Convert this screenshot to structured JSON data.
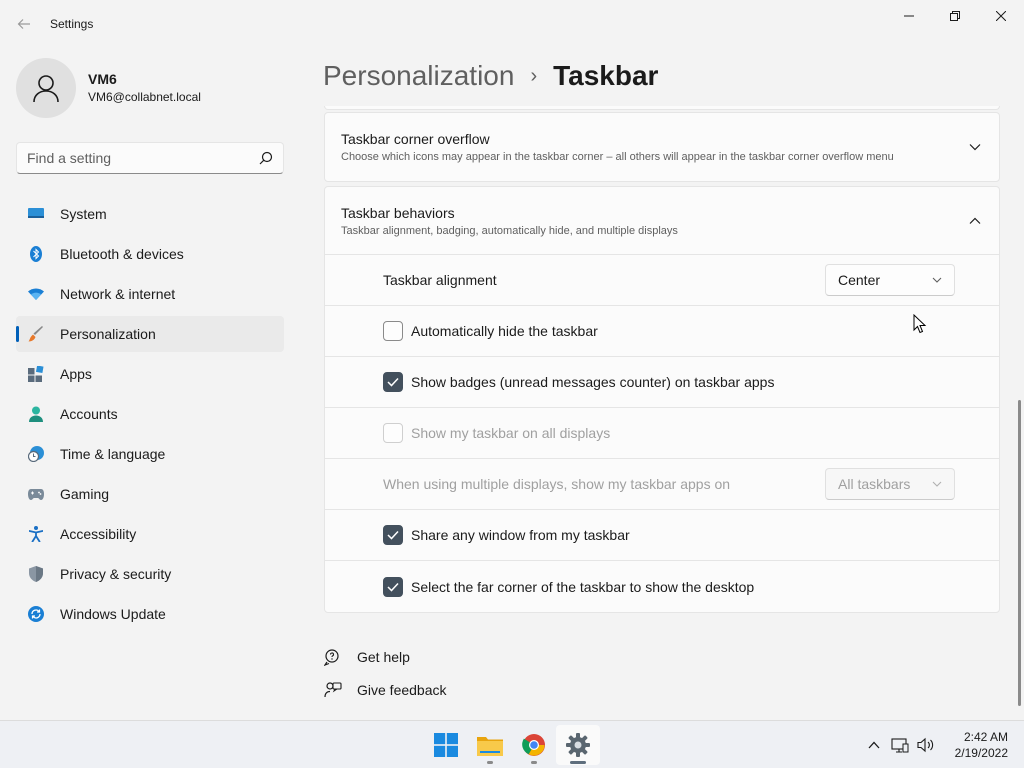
{
  "window": {
    "title": "Settings",
    "controls": [
      "minimize",
      "maximize",
      "close"
    ]
  },
  "profile": {
    "name": "VM6",
    "email": "VM6@collabnet.local"
  },
  "search": {
    "placeholder": "Find a setting"
  },
  "sidebar": {
    "items": [
      {
        "label": "System",
        "icon": "monitor-icon"
      },
      {
        "label": "Bluetooth & devices",
        "icon": "bluetooth-icon"
      },
      {
        "label": "Network & internet",
        "icon": "wifi-icon"
      },
      {
        "label": "Personalization",
        "icon": "brush-icon",
        "active": true
      },
      {
        "label": "Apps",
        "icon": "apps-icon"
      },
      {
        "label": "Accounts",
        "icon": "person-icon"
      },
      {
        "label": "Time & language",
        "icon": "clock-globe-icon"
      },
      {
        "label": "Gaming",
        "icon": "gamepad-icon"
      },
      {
        "label": "Accessibility",
        "icon": "accessibility-icon"
      },
      {
        "label": "Privacy & security",
        "icon": "shield-icon"
      },
      {
        "label": "Windows Update",
        "icon": "update-icon"
      }
    ]
  },
  "breadcrumb": {
    "parent": "Personalization",
    "separator": "›",
    "current": "Taskbar"
  },
  "corner_overflow": {
    "title": "Taskbar corner overflow",
    "description": "Choose which icons may appear in the taskbar corner – all others will appear in the taskbar corner overflow menu",
    "expanded": false
  },
  "behaviors": {
    "title": "Taskbar behaviors",
    "description": "Taskbar alignment, badging, automatically hide, and multiple displays",
    "expanded": true,
    "alignment": {
      "label": "Taskbar alignment",
      "value": "Center"
    },
    "auto_hide": {
      "label": "Automatically hide the taskbar",
      "checked": false
    },
    "badges": {
      "label": "Show badges (unread messages counter) on taskbar apps",
      "checked": true
    },
    "all_displays": {
      "label": "Show my taskbar on all displays",
      "checked": false,
      "disabled": true
    },
    "multi_display_apps": {
      "label": "When using multiple displays, show my taskbar apps on",
      "value": "All taskbars",
      "disabled": true
    },
    "share_window": {
      "label": "Share any window from my taskbar",
      "checked": true
    },
    "far_corner": {
      "label": "Select the far corner of the taskbar to show the desktop",
      "checked": true
    }
  },
  "links": {
    "help": "Get help",
    "feedback": "Give feedback"
  },
  "taskbar": {
    "apps": [
      "start-icon",
      "file-explorer-icon",
      "chrome-icon",
      "settings-icon"
    ],
    "time": "2:42 AM",
    "date": "2/19/2022"
  },
  "colors": {
    "accent": "#005fb8",
    "checkbox_checked": "#43505d",
    "background": "#f3f3f3",
    "card": "#fbfbfb"
  }
}
